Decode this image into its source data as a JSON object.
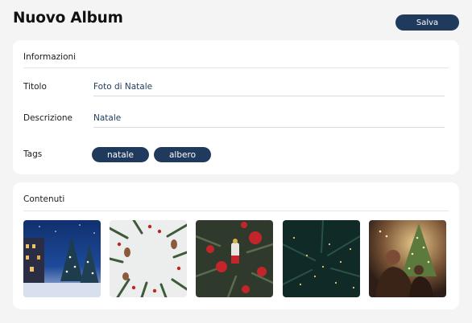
{
  "header": {
    "title": "Nuovo Album",
    "save_label": "Salva"
  },
  "info": {
    "section_title": "Informazioni",
    "fields": {
      "title": {
        "label": "Titolo",
        "value": "Foto di Natale"
      },
      "description": {
        "label": "Descrizione",
        "value": "Natale"
      },
      "tags": {
        "label": "Tags"
      }
    },
    "tags": [
      "natale",
      "albero"
    ]
  },
  "content": {
    "section_title": "Contenuti",
    "photos": [
      {
        "subject": "snowy-village-night-photo"
      },
      {
        "subject": "pine-branches-frame-photo"
      },
      {
        "subject": "christmas-ornaments-tree-photo"
      },
      {
        "subject": "dark-green-tree-lights-photo"
      },
      {
        "subject": "people-by-lit-tree-photo"
      }
    ]
  },
  "colors": {
    "accent": "#1f3a5c",
    "background": "#f4f4f5",
    "card": "#ffffff"
  }
}
